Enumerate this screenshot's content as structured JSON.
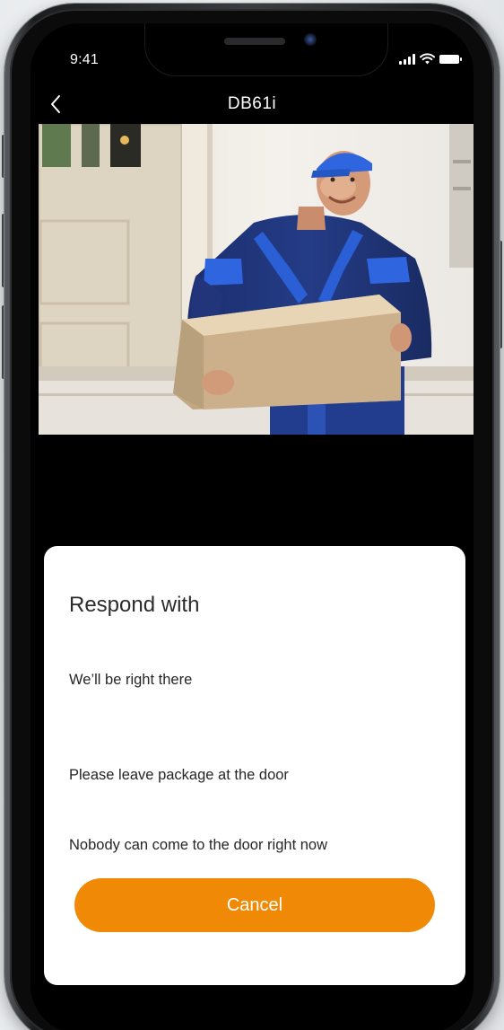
{
  "status_bar": {
    "time": "9:41",
    "icons": [
      "signal-icon",
      "wifi-icon",
      "battery-icon"
    ]
  },
  "nav": {
    "title": "DB61i",
    "back_icon": "chevron-left-icon"
  },
  "video_feed": {
    "subject": "delivery-person-with-package"
  },
  "response_sheet": {
    "title": "Respond with",
    "options": [
      "We’ll be right there",
      "Please leave package at the door",
      "Nobody can come to the door right now"
    ],
    "cancel_label": "Cancel"
  },
  "colors": {
    "accent": "#F08A06",
    "sheet_background": "#FFFFFF",
    "screen_background": "#000000"
  }
}
